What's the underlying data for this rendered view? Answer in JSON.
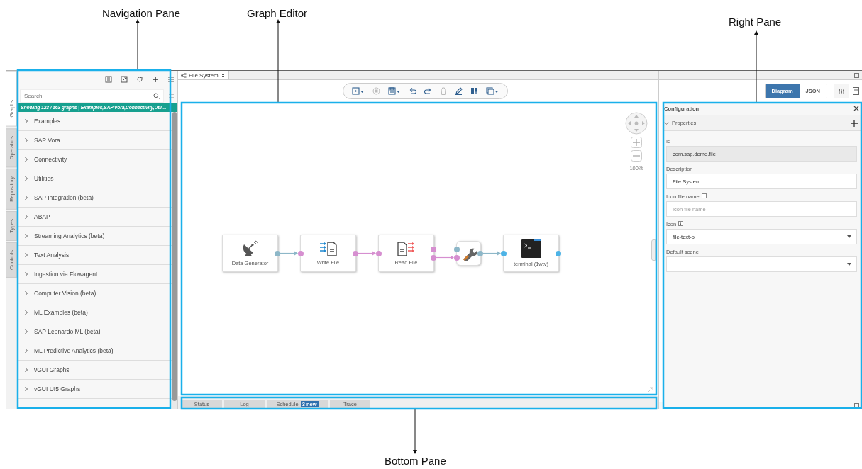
{
  "callouts": [
    {
      "label": "Navigation Pane"
    },
    {
      "label": "Graph Editor"
    },
    {
      "label": "Right Pane"
    },
    {
      "label": "Bottom Pane"
    }
  ],
  "side_tabs": [
    {
      "label": "Graphs",
      "selected": true
    },
    {
      "label": "Operators",
      "selected": false
    },
    {
      "label": "Repository",
      "selected": false
    },
    {
      "label": "Types",
      "selected": false
    },
    {
      "label": "Controls",
      "selected": false
    }
  ],
  "navigation": {
    "search": {
      "placeholder": "Search"
    },
    "banner": "Showing 123 / 163 graphs | Examples,SAP Vora,Connectivity,Util…",
    "items": [
      {
        "label": "Examples",
        "expanded": false
      },
      {
        "label": "SAP Vora",
        "expanded": false
      },
      {
        "label": "Connectivity",
        "expanded": false
      },
      {
        "label": "Utilities",
        "expanded": false
      },
      {
        "label": "SAP Integration (beta)",
        "expanded": false
      },
      {
        "label": "ABAP",
        "expanded": false
      },
      {
        "label": "Streaming Analytics (beta)",
        "expanded": false
      },
      {
        "label": "Text Analysis",
        "expanded": false
      },
      {
        "label": "Ingestion via Flowagent",
        "expanded": false
      },
      {
        "label": "Computer Vision (beta)",
        "expanded": false
      },
      {
        "label": "ML Examples (beta)",
        "expanded": false
      },
      {
        "label": "SAP Leonardo ML (beta)",
        "expanded": false
      },
      {
        "label": "ML Predictive Analytics (beta)",
        "expanded": false
      },
      {
        "label": "vGUI Graphs",
        "expanded": false
      },
      {
        "label": "vGUI UI5 Graphs",
        "expanded": false
      }
    ]
  },
  "editor": {
    "tabs": [
      {
        "label": "File System",
        "selected": true
      }
    ],
    "zoom": "100%",
    "nodes": [
      {
        "label": "Data Generator",
        "kind": "generator",
        "outputs": [
          {
            "color": "#8db7c8"
          }
        ]
      },
      {
        "label": "Write File",
        "kind": "write",
        "inputs": [
          {
            "color": "#d68fd0"
          }
        ],
        "outputs": [
          {
            "color": "#d68fd0"
          }
        ]
      },
      {
        "label": "Read File",
        "kind": "read",
        "inputs": [
          {
            "color": "#d68fd0"
          }
        ],
        "outputs": [
          {
            "color": "#d68fd0"
          },
          {
            "color": "#d68fd0"
          }
        ]
      },
      {
        "kind": "operator",
        "inputs": [
          {
            "color": "#8db7c8"
          },
          {
            "color": "#d68fd0"
          }
        ],
        "outputs": [
          {
            "color": "#8db7c8"
          }
        ]
      },
      {
        "label": "terminal (1wtv)",
        "kind": "terminal",
        "inputs": [
          {
            "color": "#4db3e6"
          }
        ],
        "outputs": [
          {
            "color": "#4db3e6"
          }
        ]
      }
    ]
  },
  "bottom_tabs": [
    {
      "label": "Status"
    },
    {
      "label": "Log"
    },
    {
      "label": "Schedule",
      "badge": "3 new"
    },
    {
      "label": "Trace"
    }
  ],
  "right_pane": {
    "view_toggle": [
      {
        "label": "Diagram",
        "selected": true
      },
      {
        "label": "JSON",
        "selected": false
      }
    ],
    "title": "Configuration",
    "section": {
      "label": "Properties",
      "expanded": true
    },
    "fields": [
      {
        "label": "Id",
        "kind": "readonly",
        "value": "com.sap.demo.file"
      },
      {
        "label": "Description",
        "kind": "text",
        "value": "File System"
      },
      {
        "label": "Icon file name",
        "kind": "text",
        "placeholder": "Icon file name",
        "info": true
      },
      {
        "label": "Icon",
        "kind": "select",
        "value": "file-text-o",
        "info": true
      },
      {
        "label": "Default scene",
        "kind": "select"
      }
    ]
  }
}
